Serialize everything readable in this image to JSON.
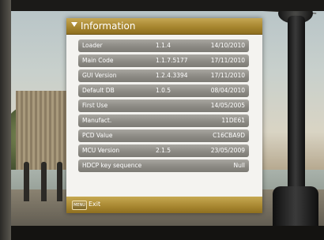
{
  "window": {
    "title": "Information"
  },
  "rows": [
    {
      "label": "Loader",
      "version": "1.1.4",
      "date": "14/10/2010"
    },
    {
      "label": "Main Code",
      "version": "1.1.7.5177",
      "date": "17/11/2010"
    },
    {
      "label": "GUI Version",
      "version": "1.2.4.3394",
      "date": "17/11/2010"
    },
    {
      "label": "Default DB",
      "version": "1.0.5",
      "date": "08/04/2010"
    },
    {
      "label": "First Use",
      "version": "",
      "date": "14/05/2005"
    },
    {
      "label": "Manufact.",
      "version": "",
      "date": "11DE61"
    },
    {
      "label": "PCD Value",
      "version": "",
      "date": "C16CBA9D"
    },
    {
      "label": "MCU Version",
      "version": "2.1.5",
      "date": "23/05/2009"
    },
    {
      "label": "HDCP key sequence",
      "version": "",
      "date": "Null"
    }
  ],
  "footer": {
    "menu_key": "MENU",
    "exit_label": "Exit"
  },
  "icons": {
    "header": "dropdown-triangle-icon",
    "menu_key": "menu-key-icon"
  },
  "colors": {
    "accent": "#a7862f",
    "row": "#8e8c86",
    "panel": "#f4f3f0"
  }
}
